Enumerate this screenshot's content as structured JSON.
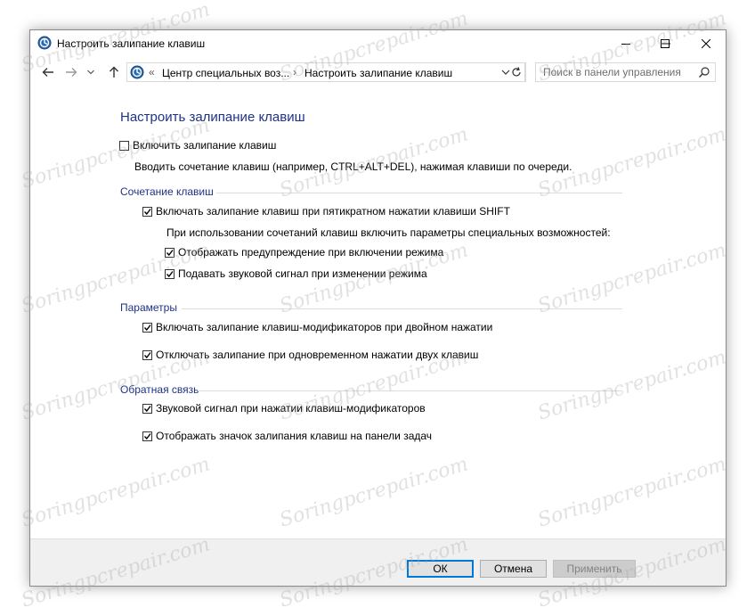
{
  "window": {
    "title": "Настроить залипание клавиш"
  },
  "nav": {
    "breadcrumb_prefix": "«",
    "crumb1": "Центр специальных воз...",
    "crumb_sep": "›",
    "crumb2": "Настроить залипание клавиш",
    "search_placeholder": "Поиск в панели управления"
  },
  "main": {
    "heading": "Настроить залипание клавиш",
    "enable": {
      "label": "Включить залипание клавиш",
      "checked": false
    },
    "enable_desc": "Вводить сочетание клавиш (например, CTRL+ALT+DEL), нажимая клавиши по очереди."
  },
  "shortcut": {
    "title": "Сочетание клавиш",
    "shift5": {
      "label": "Включать залипание клавиш при пятикратном нажатии клавиши SHIFT",
      "checked": true
    },
    "note": "При использовании сочетаний клавиш включить параметры специальных возможностей:",
    "warn": {
      "label": "Отображать предупреждение при включении режима",
      "checked": true
    },
    "sound": {
      "label": "Подавать звуковой сигнал при изменении режима",
      "checked": true
    }
  },
  "params": {
    "title": "Параметры",
    "lock_modifier": {
      "label": "Включать залипание клавиш-модификаторов при двойном нажатии",
      "checked": true
    },
    "disable_two": {
      "label": "Отключать залипание при одновременном нажатии двух клавиш",
      "checked": true
    }
  },
  "feedback": {
    "title": "Обратная связь",
    "beep": {
      "label": "Звуковой сигнал при нажатии клавиш-модификаторов",
      "checked": true
    },
    "taskbar_icon": {
      "label": "Отображать значок залипания клавиш на панели задач",
      "checked": true
    }
  },
  "buttons": {
    "ok": "ОК",
    "cancel": "Отмена",
    "apply": "Применить"
  },
  "watermark": "Soringpcrepair.com",
  "colors": {
    "heading": "#1e3287",
    "footer_bg": "#f0f0f0",
    "ok_border": "#0078d7"
  }
}
